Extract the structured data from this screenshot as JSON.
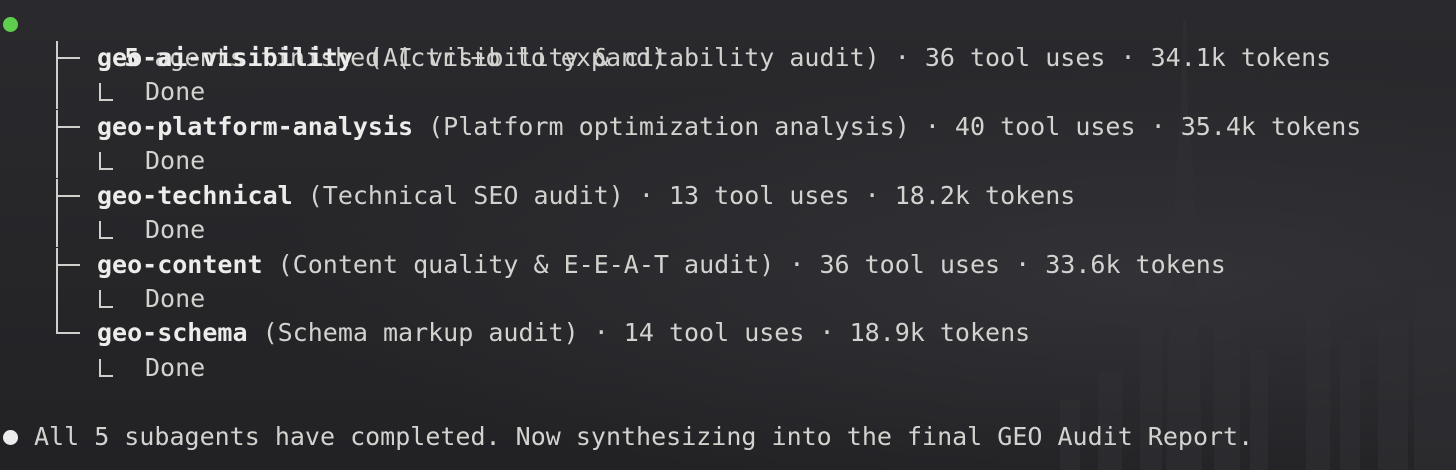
{
  "header": {
    "count": "5",
    "label": " agents finished (ctrl+o to expand)"
  },
  "agents": [
    {
      "name": "geo-ai-visibility",
      "detail": " (AI visibility & citability audit) · 36 tool uses · 34.1k tokens",
      "status": "Done"
    },
    {
      "name": "geo-platform-analysis",
      "detail": " (Platform optimization analysis) · 40 tool uses · 35.4k tokens",
      "status": "Done"
    },
    {
      "name": "geo-technical",
      "detail": " (Technical SEO audit) · 13 tool uses · 18.2k tokens",
      "status": "Done"
    },
    {
      "name": "geo-content",
      "detail": " (Content quality & E-E-A-T audit) · 36 tool uses · 33.6k tokens",
      "status": "Done"
    },
    {
      "name": "geo-schema",
      "detail": " (Schema markup audit) · 14 tool uses · 18.9k tokens",
      "status": "Done"
    }
  ],
  "message": "All 5 subagents have completed. Now synthesizing into the final GEO Audit Report.",
  "colors": {
    "background": "#26262a",
    "text": "#d7d7d4",
    "bullet_finished": "#5fce4f",
    "bullet_message": "#ececec"
  }
}
